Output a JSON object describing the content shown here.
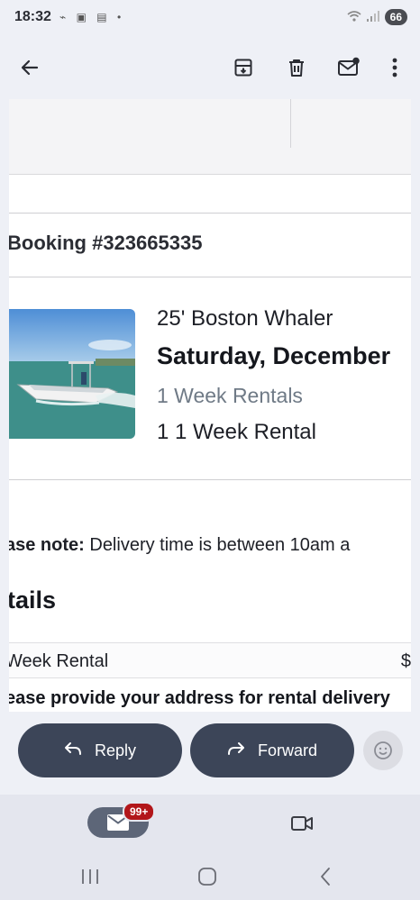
{
  "status_bar": {
    "time": "18:32",
    "battery": "66",
    "notification_icons": [
      "voicemail-icon",
      "screenshot-icon",
      "calendar-icon",
      "dot-icon"
    ],
    "system_icons": [
      "wifi-icon",
      "signal-icon",
      "battery-icon"
    ]
  },
  "app_bar": {
    "icons": [
      "back-arrow-icon",
      "archive-icon",
      "delete-icon",
      "mark-unread-icon",
      "more-vert-icon"
    ]
  },
  "email": {
    "booking_title": "Booking #323665335",
    "boat_name": "25' Boston Whaler",
    "date": "Saturday, December",
    "rental_type": "1 Week Rentals",
    "rental_qty": "1 1 Week Rental",
    "note_label": "ase note:",
    "note_text": " Delivery time is between 10am a",
    "details_heading": "tails",
    "line_item": "Week Rental",
    "line_price": "$",
    "address_note": "ease provide your address for rental delivery"
  },
  "actions": {
    "reply_label": "Reply",
    "forward_label": "Forward"
  },
  "bottom_nav": {
    "mail_badge": "99+"
  },
  "colors": {
    "accent_pill": "#3c4558",
    "badge": "#b2161a",
    "background": "#eef0f6"
  }
}
